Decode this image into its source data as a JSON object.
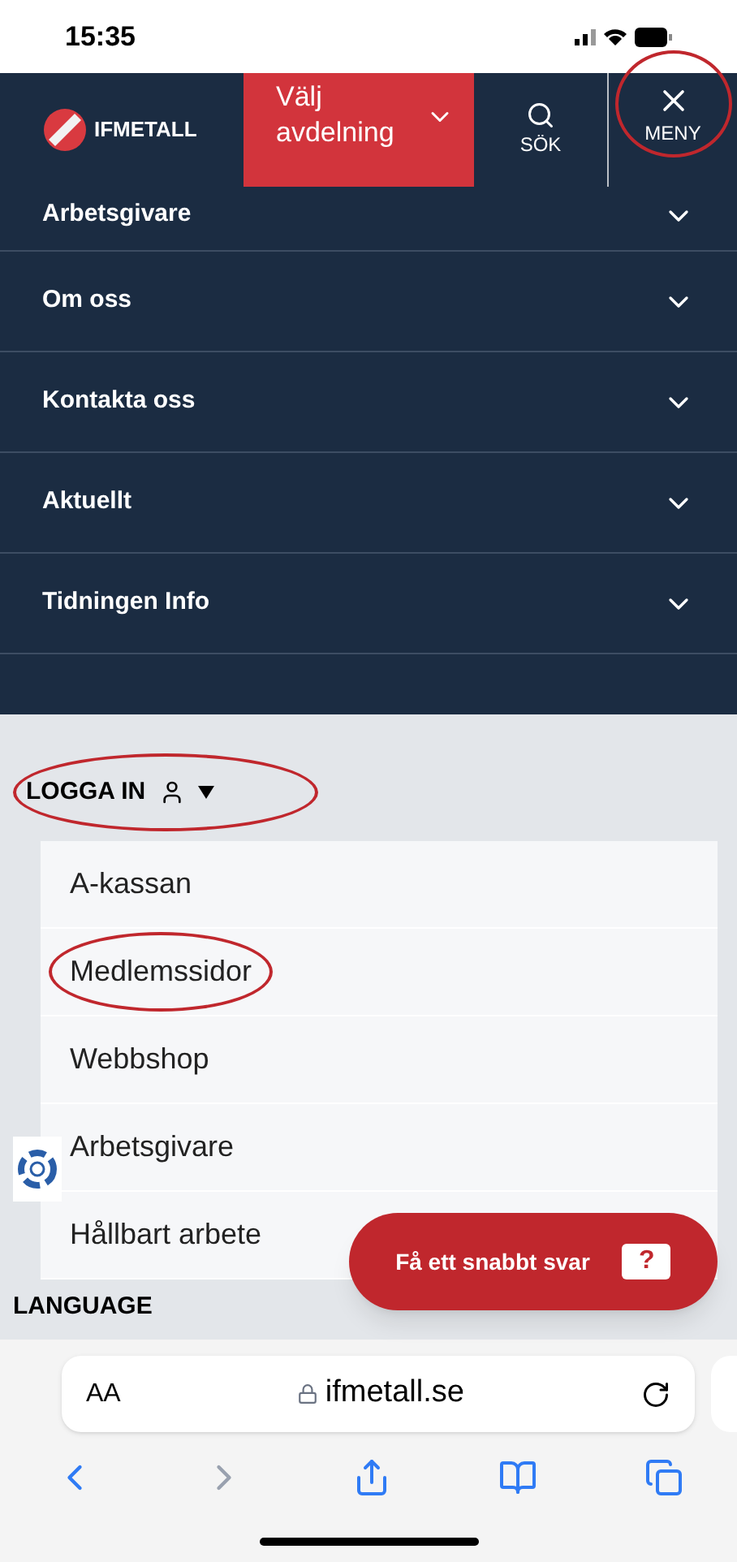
{
  "status_bar": {
    "time": "15:35"
  },
  "header": {
    "logo": "IFMETALL",
    "branch_select": {
      "label": "Välj avdelning"
    },
    "search": {
      "label": "SÖK"
    },
    "menu_button": {
      "label": "MENY",
      "circled": true
    }
  },
  "menu_items": [
    {
      "label": "Arbetsgivare",
      "expanded": false
    },
    {
      "label": "Om oss",
      "expanded": false
    },
    {
      "label": "Kontakta oss",
      "expanded": false
    },
    {
      "label": "Aktuellt",
      "expanded": false
    },
    {
      "label": "Tidningen Info",
      "expanded": false
    }
  ],
  "login": {
    "label": "LOGGA IN",
    "circled": true,
    "expanded": true
  },
  "login_items": [
    {
      "label": "A-kassan",
      "circled": false
    },
    {
      "label": "Medlemssidor",
      "circled": true
    },
    {
      "label": "Webbshop",
      "circled": false
    },
    {
      "label": "Arbetsgivare",
      "circled": false
    },
    {
      "label": "Hållbart arbete",
      "circled": false
    }
  ],
  "language_heading": "LANGUAGE",
  "chat_button": {
    "label": "Få ett snabbt svar",
    "icon_text": "?"
  },
  "browser": {
    "text_size": "AA",
    "url": "ifmetall.se"
  }
}
